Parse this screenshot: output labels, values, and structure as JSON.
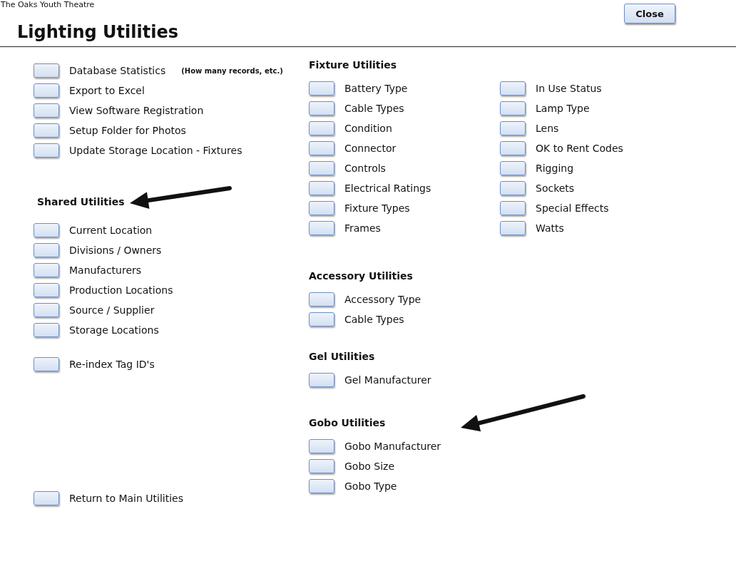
{
  "app_name": "The Oaks Youth Theatre",
  "close_button": "Close",
  "title": "Lighting Utilities",
  "left_groups": [
    {
      "items": [
        {
          "label": "Database Statistics",
          "note": "(How many records, etc.)",
          "focused": true
        },
        {
          "label": "Export to Excel",
          "focused": false
        },
        {
          "label": "View Software Registration",
          "focused": false
        },
        {
          "label": "Setup Folder for Photos",
          "focused": false
        },
        {
          "label": "Update Storage Location - Fixtures",
          "focused": false
        }
      ]
    },
    {
      "heading": "Shared Utilities",
      "items": [
        {
          "label": "Current Location"
        },
        {
          "label": "Divisions / Owners"
        },
        {
          "label": "Manufacturers"
        },
        {
          "label": "Production Locations"
        },
        {
          "label": "Source / Supplier"
        },
        {
          "label": "Storage Locations"
        }
      ]
    },
    {
      "items": [
        {
          "label": "Re-index Tag ID's"
        }
      ]
    },
    {
      "items": [
        {
          "label": "Return to Main Utilities"
        }
      ]
    }
  ],
  "right_sections": [
    {
      "heading": "Fixture Utilities",
      "columns": [
        [
          "Battery Type",
          "Cable Types",
          "Condition",
          "Connector",
          "Controls",
          "Electrical Ratings",
          "Fixture Types",
          "Frames"
        ],
        [
          "In Use Status",
          "Lamp Type",
          "Lens",
          "OK to Rent Codes",
          "Rigging",
          "Sockets",
          "Special Effects",
          "Watts"
        ]
      ]
    },
    {
      "heading": "Accessory Utilities",
      "columns": [
        [
          "Accessory Type",
          "Cable Types"
        ]
      ]
    },
    {
      "heading": "Gel Utilities",
      "columns": [
        [
          "Gel Manufacturer"
        ]
      ]
    },
    {
      "heading": "Gobo Utilities",
      "columns": [
        [
          "Gobo Manufacturer",
          "Gobo Size",
          "Gobo Type"
        ]
      ]
    }
  ]
}
